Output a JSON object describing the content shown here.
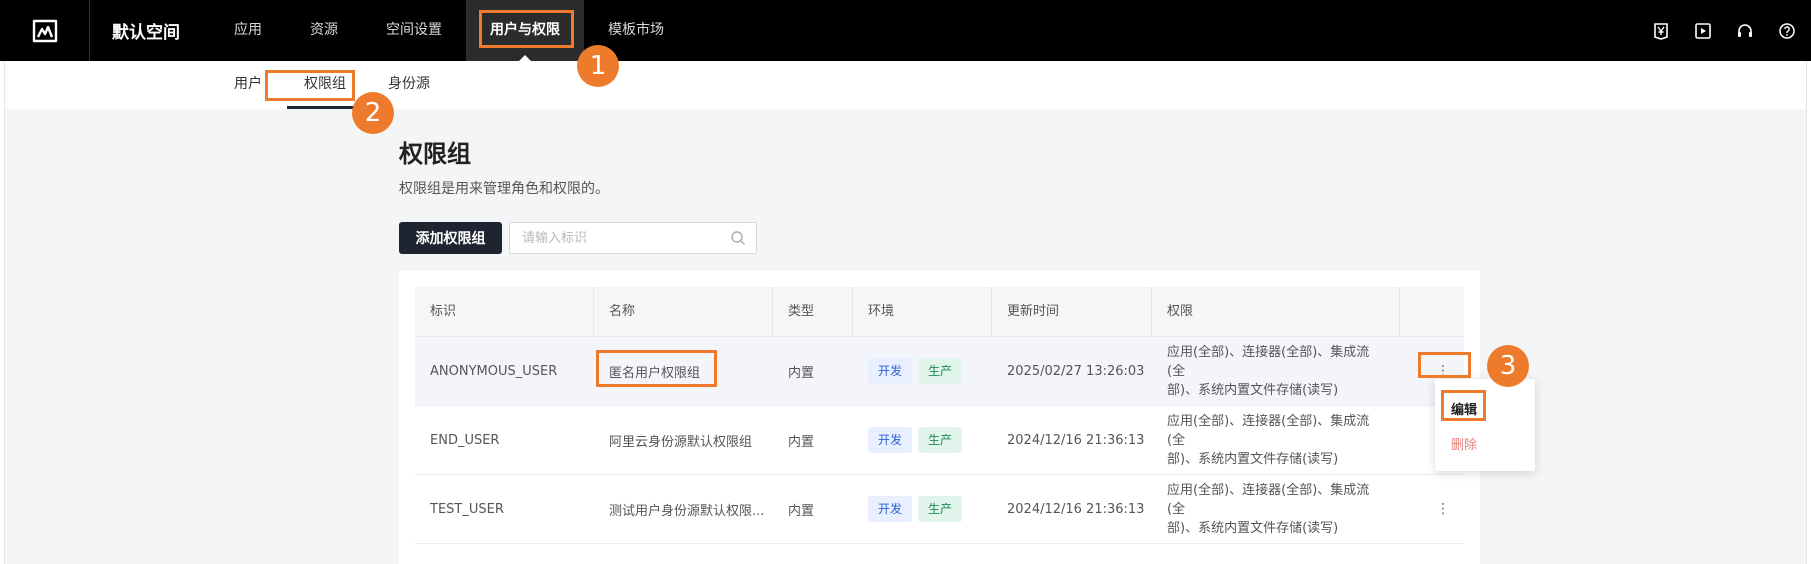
{
  "topbar": {
    "workspace": "默认空间",
    "nav": [
      "应用",
      "资源",
      "空间设置",
      "用户与权限",
      "模板市场"
    ],
    "active_nav": 3,
    "icons": [
      "yen-bill-icon",
      "video-icon",
      "headset-icon",
      "help-icon"
    ]
  },
  "subtabs": [
    "用户",
    "权限组",
    "身份源"
  ],
  "page": {
    "title": "权限组",
    "description": "权限组是用来管理角色和权限的。",
    "add_button": "添加权限组",
    "search_placeholder": "请输入标识"
  },
  "table": {
    "columns": [
      "标识",
      "名称",
      "类型",
      "环境",
      "更新时间",
      "权限"
    ],
    "rows": [
      {
        "id": "ANONYMOUS_USER",
        "name": "匿名用户权限组",
        "type": "内置",
        "env": [
          "开发",
          "生产"
        ],
        "updated": "2025/02/27 13:26:03",
        "perm": [
          "应用(全部)、连接器(全部)、集成流(全",
          "部)、系统内置文件存储(读写)"
        ]
      },
      {
        "id": "END_USER",
        "name": "阿里云身份源默认权限组",
        "type": "内置",
        "env": [
          "开发",
          "生产"
        ],
        "updated": "2024/12/16 21:36:13",
        "perm": [
          "应用(全部)、连接器(全部)、集成流(全",
          "部)、系统内置文件存储(读写)"
        ]
      },
      {
        "id": "TEST_USER",
        "name": "测试用户身份源默认权限...",
        "type": "内置",
        "env": [
          "开发",
          "生产"
        ],
        "updated": "2024/12/16 21:36:13",
        "perm": [
          "应用(全部)、连接器(全部)、集成流(全",
          "部)、系统内置文件存储(读写)"
        ]
      }
    ],
    "more": "⋮"
  },
  "dropdown": {
    "edit": "编辑",
    "delete": "删除"
  },
  "badges": [
    "1",
    "2",
    "3"
  ],
  "colors": {
    "accent": "#ee7b2b",
    "dark": "#1f2530"
  }
}
